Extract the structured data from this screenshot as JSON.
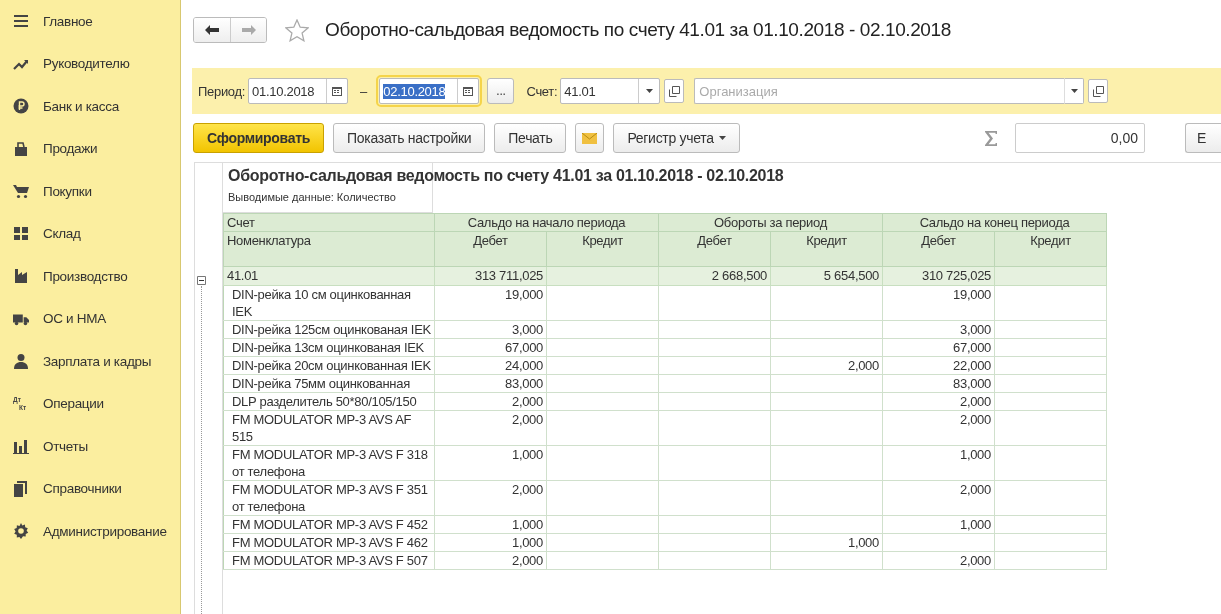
{
  "sidebar": {
    "items": [
      {
        "label": "Главное"
      },
      {
        "label": "Руководителю"
      },
      {
        "label": "Банк и касса"
      },
      {
        "label": "Продажи"
      },
      {
        "label": "Покупки"
      },
      {
        "label": "Склад"
      },
      {
        "label": "Производство"
      },
      {
        "label": "ОС и НМА"
      },
      {
        "label": "Зарплата и кадры"
      },
      {
        "label": "Операции",
        "glyphs": [
          "Дт",
          "Кт"
        ]
      },
      {
        "label": "Отчеты"
      },
      {
        "label": "Справочники"
      },
      {
        "label": "Администрирование"
      }
    ]
  },
  "header": {
    "title": "Оборотно-сальдовая ведомость по счету 41.01 за 01.10.2018 - 02.10.2018",
    "favorite": false
  },
  "filters": {
    "period_label": "Период:",
    "date_from": "01.10.2018",
    "dash": "–",
    "date_to": "02.10.2018",
    "more": "...",
    "account_label": "Счет:",
    "account": "41.01",
    "organization_placeholder": "Организация"
  },
  "toolbar": {
    "buttons": [
      {
        "label": "Сформировать",
        "kind": "primary"
      },
      {
        "label": "Показать настройки",
        "kind": "plain"
      },
      {
        "label": "Печать",
        "kind": "plain"
      },
      {
        "kind": "mail"
      },
      {
        "label": "Регистр учета",
        "kind": "dropdown"
      }
    ],
    "sum_value": "0,00",
    "more": "Е"
  },
  "report": {
    "title": "Оборотно-сальдовая ведомость по счету 41.01 за 01.10.2018 - 02.10.2018",
    "output_label": "Выводимые данные:  Количество",
    "header_top": [
      "Счет",
      "Сальдо на начало периода",
      "Обороты за период",
      "Сальдо на конец периода"
    ],
    "header_sub": [
      "Номенклатура",
      "Дебет",
      "Кредит",
      "Дебет",
      "Кредит",
      "Дебет",
      "Кредит"
    ],
    "group": {
      "account": "41.01",
      "expanded": true,
      "opening_debit": "313 711,025",
      "turnover_debit": "2 668,500",
      "turnover_credit": "5 654,500",
      "closing_debit": "310 725,025"
    },
    "rows": [
      {
        "name": "DIN-рейка 10 см оцинкованная IEK",
        "opening_debit": "19,000",
        "closing_debit": "19,000"
      },
      {
        "name": "DIN-рейка 125см оцинкованая IEK",
        "opening_debit": "3,000",
        "closing_debit": "3,000"
      },
      {
        "name": "DIN-рейка 13см оцинкованая IEK",
        "opening_debit": "67,000",
        "closing_debit": "67,000"
      },
      {
        "name": "DIN-рейка 20см оцинкованная IEK",
        "opening_debit": "24,000",
        "turnover_credit": "2,000",
        "closing_debit": "22,000"
      },
      {
        "name": "DIN-рейка 75мм оцинкованная",
        "opening_debit": "83,000",
        "closing_debit": "83,000"
      },
      {
        "name": "DLP разделитель 50*80/105/150",
        "opening_debit": "2,000",
        "closing_debit": "2,000"
      },
      {
        "name": "FM MODULATOR MP-3 AVS AF 515",
        "opening_debit": "2,000",
        "closing_debit": "2,000"
      },
      {
        "name": "FM MODULATOR MP-3 AVS F 318 от телефона",
        "opening_debit": "1,000",
        "closing_debit": "1,000"
      },
      {
        "name": "FM MODULATOR MP-3 AVS F 351 от телефона",
        "opening_debit": "2,000",
        "closing_debit": "2,000"
      },
      {
        "name": "FM MODULATOR MP-3 AVS F 452",
        "opening_debit": "1,000",
        "closing_debit": "1,000"
      },
      {
        "name": "FM MODULATOR MP-3 AVS F 462",
        "opening_debit": "1,000",
        "turnover_credit": "1,000"
      },
      {
        "name": "FM MODULATOR MP-3 AVS F 507",
        "opening_debit": "2,000",
        "closing_debit": "2,000"
      }
    ]
  }
}
